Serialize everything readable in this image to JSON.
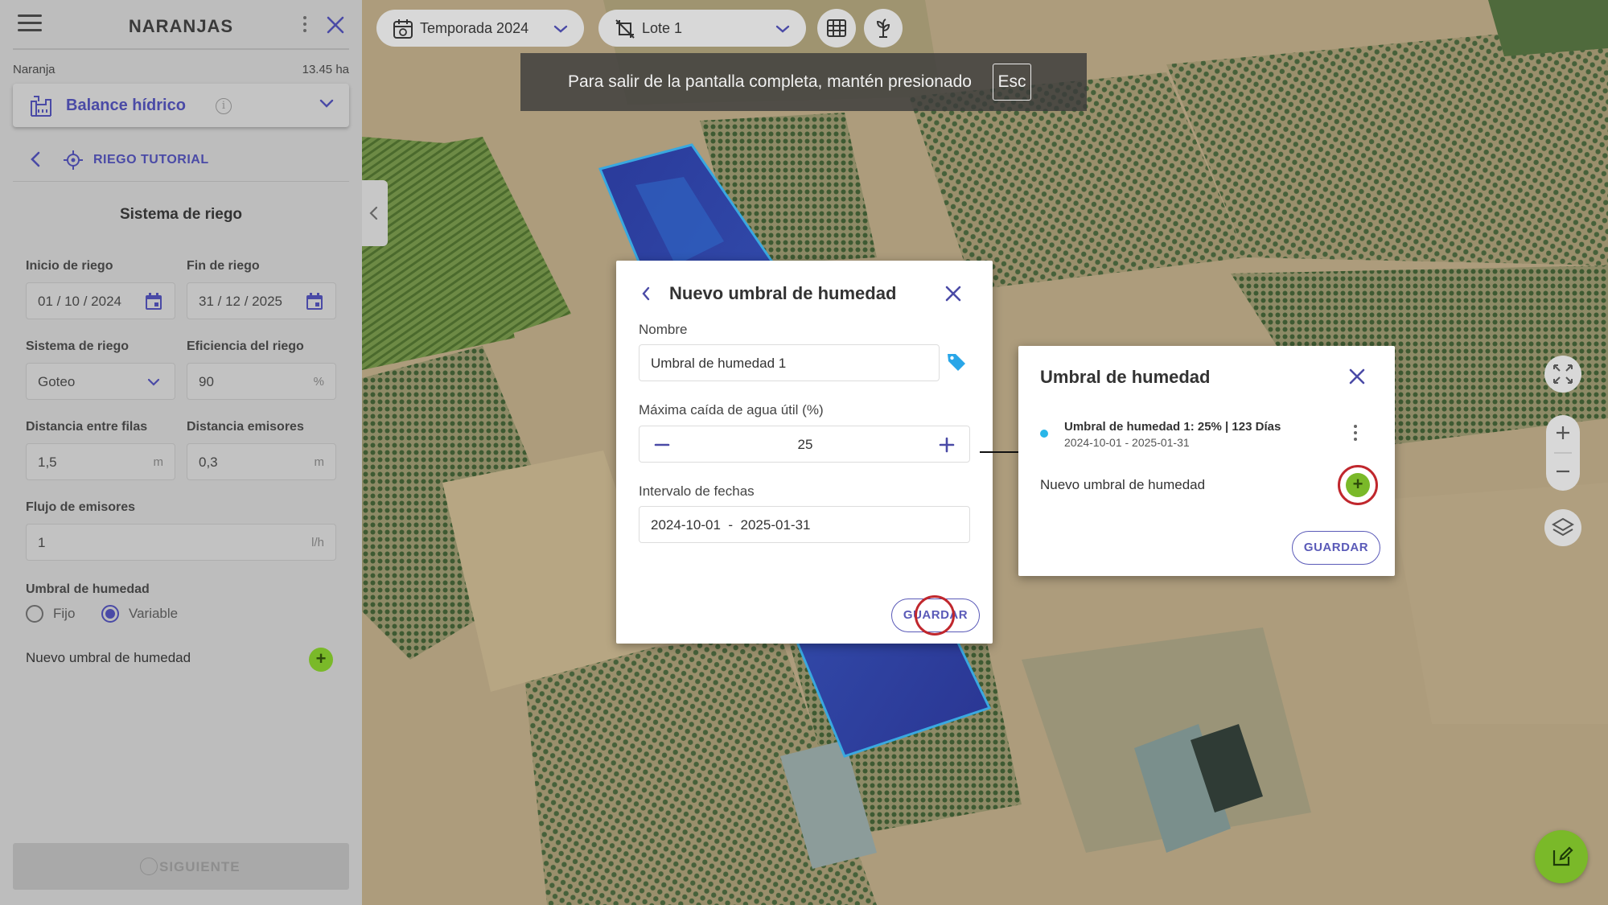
{
  "sidebar": {
    "title": "NARANJAS",
    "crop_name": "Naranja",
    "crop_area": "13.45 ha",
    "module": {
      "label": "Balance hídrico",
      "icon": "irrigation-icon"
    },
    "tutorial": {
      "label": "RIEGO TUTORIAL",
      "icon": "target-icon"
    },
    "section_title": "Sistema de riego",
    "fields": {
      "inicio": {
        "label": "Inicio de riego",
        "value": "01 / 10 / 2024"
      },
      "fin": {
        "label": "Fin de riego",
        "value": "31 / 12 / 2025"
      },
      "sistema": {
        "label": "Sistema de riego",
        "value": "Goteo"
      },
      "eficiencia": {
        "label": "Eficiencia del riego",
        "value": "90",
        "unit": "%"
      },
      "dist_filas": {
        "label": "Distancia entre filas",
        "value": "1,5",
        "unit": "m"
      },
      "dist_emisores": {
        "label": "Distancia emisores",
        "value": "0,3",
        "unit": "m"
      },
      "flujo": {
        "label": "Flujo de emisores",
        "value": "1",
        "unit": "l/h"
      }
    },
    "umbral": {
      "label": "Umbral de humedad",
      "options": [
        "Fijo",
        "Variable"
      ],
      "selected": "Variable"
    },
    "new_umbral_label": "Nuevo umbral de humedad",
    "next_label": "SIGUIENTE"
  },
  "topbar": {
    "season": "Temporada 2024",
    "lot": "Lote 1"
  },
  "fullscreen_banner": {
    "text": "Para salir de la pantalla completa, mantén presionado",
    "key": "Esc"
  },
  "modal_new": {
    "title": "Nuevo umbral de humedad",
    "name_label": "Nombre",
    "name_value": "Umbral de humedad 1",
    "max_label": "Máxima caída de agua útil (%)",
    "max_value": "25",
    "interval_label": "Intervalo de fechas",
    "interval_value": "2024-10-01  -  2025-01-31",
    "save_label": "GUARDAR"
  },
  "modal_list": {
    "title": "Umbral de humedad",
    "items": [
      {
        "title": "Umbral de humedad 1: 25% | 123 Días",
        "dates": "2024-10-01 - 2025-01-31"
      }
    ],
    "new_label": "Nuevo umbral de humedad",
    "save_label": "GUARDAR"
  },
  "colors": {
    "accent": "#4a4aa6",
    "green": "#7ab929",
    "highlight": "#c0272d",
    "dot": "#29b6e8"
  }
}
